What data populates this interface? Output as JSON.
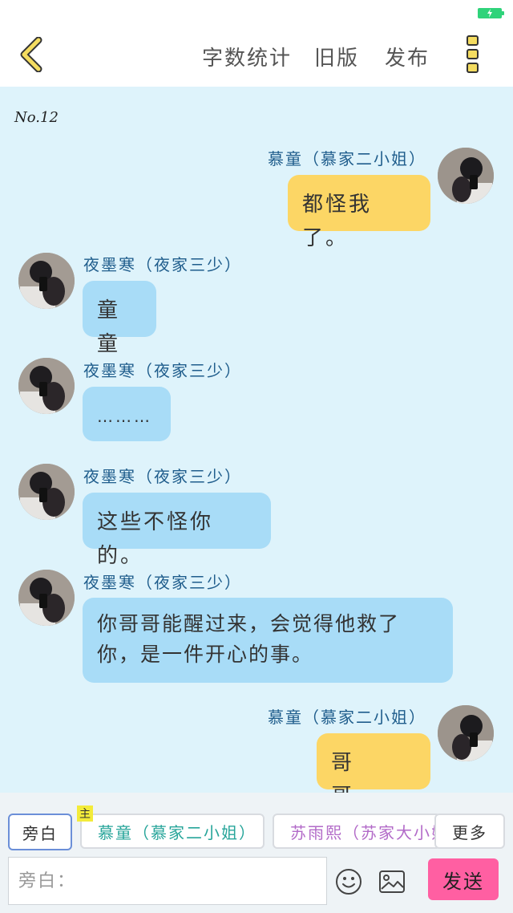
{
  "status_bar": {
    "battery_color": "#2fd37a"
  },
  "nav": {
    "back_icon": "chevron-left-icon",
    "word_count": "字数统计",
    "old_version": "旧版",
    "publish": "发布",
    "more_icon": "more-icon"
  },
  "chat": {
    "chapter_no": "No.12",
    "messages": [
      {
        "side": "right",
        "speaker": "慕童（慕家二小姐）",
        "text": "都怪我了。",
        "bubble_color": "#fcd665"
      },
      {
        "side": "left",
        "speaker": "夜墨寒（夜家三少）",
        "text": "童童",
        "bubble_color": "#a8dcf7"
      },
      {
        "side": "left",
        "speaker": "夜墨寒（夜家三少）",
        "text": "………",
        "bubble_color": "#a8dcf7"
      },
      {
        "side": "left",
        "speaker": "夜墨寒（夜家三少）",
        "text": "这些不怪你的。",
        "bubble_color": "#a8dcf7"
      },
      {
        "side": "left",
        "speaker": "夜墨寒（夜家三少）",
        "text": "你哥哥能醒过来，会觉得他救了你，是一件开心的事。",
        "bubble_color": "#a8dcf7"
      },
      {
        "side": "right",
        "speaker": "慕童（慕家二小姐）",
        "text": "哥哥……",
        "bubble_color": "#fcd665"
      }
    ]
  },
  "bottom": {
    "roles": {
      "narration": "旁白",
      "main_tag": "主",
      "mutong": "慕童（慕家二小姐）",
      "suyuxi": "苏雨熙（苏家大小姐）",
      "more": "更多"
    },
    "input_placeholder": "旁白：",
    "emoji_icon": "smiley-icon",
    "image_icon": "image-icon",
    "send": "发送"
  },
  "colors": {
    "chat_background": "#def3fb",
    "speaker_name": "#1f5d8c",
    "role_mutong": "#27a59a",
    "role_suyuxi": "#b26ac8",
    "send_button": "#ff5fa2"
  }
}
